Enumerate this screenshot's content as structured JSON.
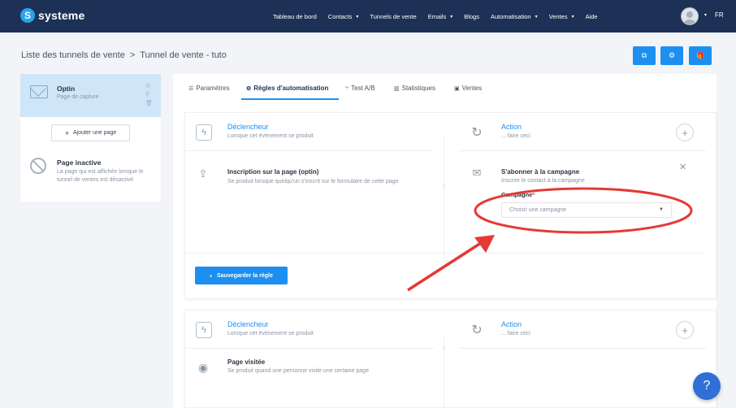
{
  "brand": {
    "logo_letter": "S",
    "name": "systeme"
  },
  "nav": {
    "items": [
      {
        "label": "Tableau de bord",
        "caret": false
      },
      {
        "label": "Contacts",
        "caret": true
      },
      {
        "label": "Tunnels de vente",
        "caret": false
      },
      {
        "label": "Emails",
        "caret": true
      },
      {
        "label": "Blogs",
        "caret": false
      },
      {
        "label": "Automatisation",
        "caret": true
      },
      {
        "label": "Ventes",
        "caret": true
      },
      {
        "label": "Aide",
        "caret": false
      }
    ],
    "lang": "FR",
    "caret_glyph": "▾"
  },
  "breadcrumb": {
    "parent": "Liste des tunnels de vente",
    "separator": ">",
    "current": "Tunnel de vente - tuto"
  },
  "top_buttons": {
    "external": "⧉",
    "settings": "⚙",
    "gift": "🎁"
  },
  "sidebar": {
    "page": {
      "title": "Optin",
      "subtitle": "Page de capture",
      "actions": [
        "◎",
        "⚲",
        "🗑"
      ]
    },
    "add_page": {
      "plus": "+",
      "label": "Ajouter une page"
    },
    "inactive": {
      "title": "Page inactive",
      "description": "La page qui est affichée lorsque le tunnel de ventes est désactivé"
    }
  },
  "tabs": [
    {
      "icon": "☰",
      "label": "Paramètres",
      "active": false
    },
    {
      "icon": "⚙",
      "label": "Règles d'automatisation",
      "active": true
    },
    {
      "icon": "⑂",
      "label": "Test A/B",
      "active": false
    },
    {
      "icon": "▥",
      "label": "Statistiques",
      "active": false
    },
    {
      "icon": "▣",
      "label": "Ventes",
      "active": false
    }
  ],
  "rule1": {
    "trigger_title": "Déclencheur",
    "trigger_sub": "Lorsque cet événement se produit",
    "action_title": "Action",
    "action_sub": "... faire ceci",
    "trigger_item_title": "Inscription sur la page (optin)",
    "trigger_item_desc": "Se produit lorsque quelqu'un s'inscrit sur le formulaire de cette page",
    "action_item_title": "S'abonner à la campagne",
    "action_item_desc": "Inscrire le contact à la campagne",
    "field_label": "Campagne",
    "required_mark": "*",
    "select_placeholder": "Choisir une campagne",
    "save_label": "Sauvegarder la règle"
  },
  "rule2": {
    "trigger_title": "Déclencheur",
    "trigger_sub": "Lorsque cet événement se produit",
    "action_title": "Action",
    "action_sub": "... faire ceci",
    "trigger_item_title": "Page visitée",
    "trigger_item_desc": "Se produit quand une personne visite une certaine page"
  },
  "help": {
    "label": "?"
  },
  "colors": {
    "navbar": "#1c3155",
    "accent": "#1d8ff0",
    "selected_page": "#cfe6f8",
    "annotation_red": "#e53935",
    "help_button": "#2f6fd6"
  },
  "icons": {
    "trigger": "bolt-icon",
    "action": "lightning-refresh-icon",
    "optin": "form-upload-icon",
    "subscribe": "campaign-icon",
    "visit": "eye-icon"
  }
}
